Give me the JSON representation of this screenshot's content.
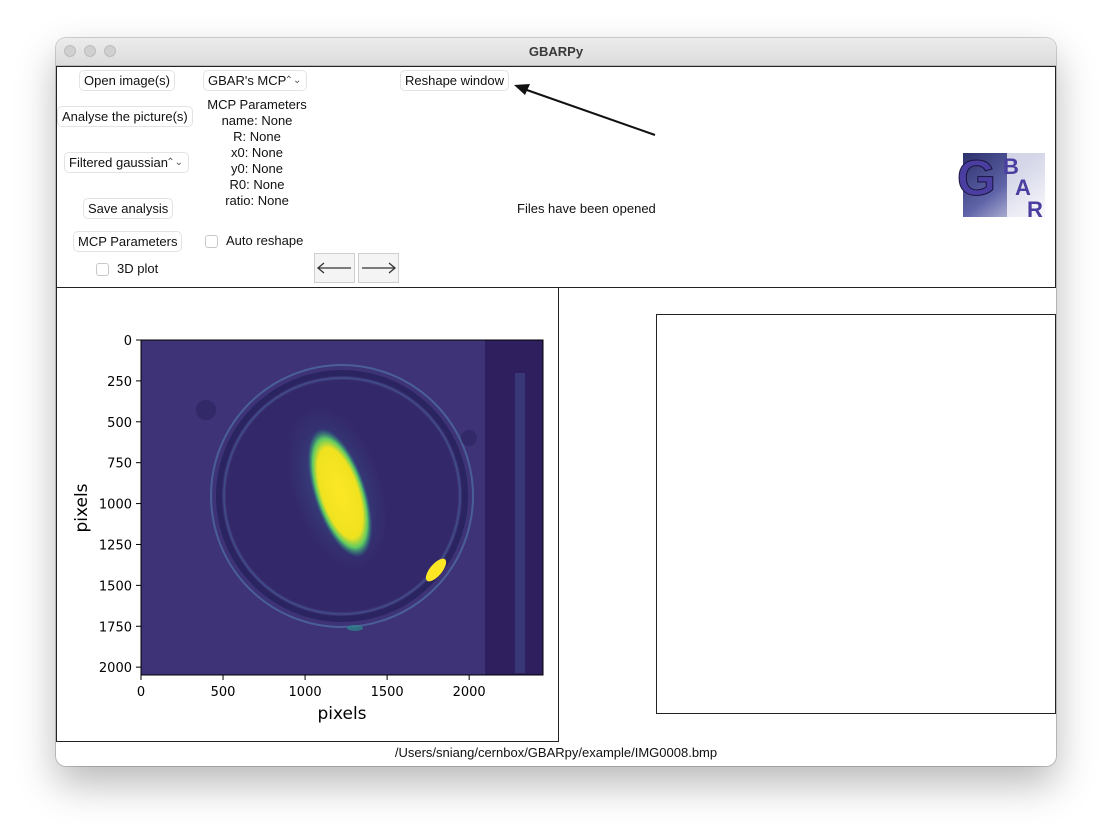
{
  "window": {
    "title": "GBARPy"
  },
  "toolbar": {
    "open_images": "Open image(s)",
    "mcp_select": "GBAR's MCP",
    "reshape_window": "Reshape window",
    "analyse": "Analyse the picture(s)",
    "fit_select": "Filtered gaussian",
    "save_analysis": "Save analysis",
    "mcp_parameters_button": "MCP Parameters",
    "auto_reshape": "Auto reshape",
    "plot_3d": "3D plot",
    "status_message": "Files have been opened"
  },
  "mcp_params": {
    "heading": "MCP Parameters",
    "lines": [
      "name: None",
      "R: None",
      "x0: None",
      "y0: None",
      "R0: None",
      "ratio: None"
    ]
  },
  "logo": {
    "letters": [
      "G",
      "B",
      "A",
      "R"
    ]
  },
  "image_plot": {
    "xlabel": "pixels",
    "ylabel": "pixels",
    "x_ticks": [
      "0",
      "500",
      "1000",
      "1500",
      "2000"
    ],
    "y_ticks": [
      "0",
      "250",
      "500",
      "750",
      "1000",
      "1250",
      "1500",
      "1750",
      "2000"
    ]
  },
  "colors": {
    "viridis_low": "#440154",
    "viridis_bg": "#39316f",
    "viridis_high": "#fde725"
  },
  "status_bar": {
    "path": "/Users/sniang/cernbox/GBARpy/example/IMG0008.bmp"
  }
}
